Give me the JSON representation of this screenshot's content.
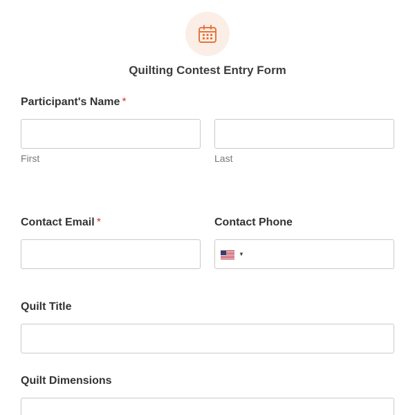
{
  "form": {
    "title": "Quilting Contest Entry Form",
    "icon": "calendar-icon",
    "accent_color": "#e8743b",
    "icon_bg_color": "#fbeee6"
  },
  "fields": {
    "participant_name": {
      "label": "Participant's Name",
      "required_marker": "*",
      "first": {
        "value": "",
        "sublabel": "First"
      },
      "last": {
        "value": "",
        "sublabel": "Last"
      }
    },
    "contact_email": {
      "label": "Contact Email",
      "required_marker": "*",
      "value": ""
    },
    "contact_phone": {
      "label": "Contact Phone",
      "country_flag": "us-flag-icon",
      "value": ""
    },
    "quilt_title": {
      "label": "Quilt Title",
      "value": ""
    },
    "quilt_dimensions": {
      "label": "Quilt Dimensions",
      "value": ""
    }
  }
}
